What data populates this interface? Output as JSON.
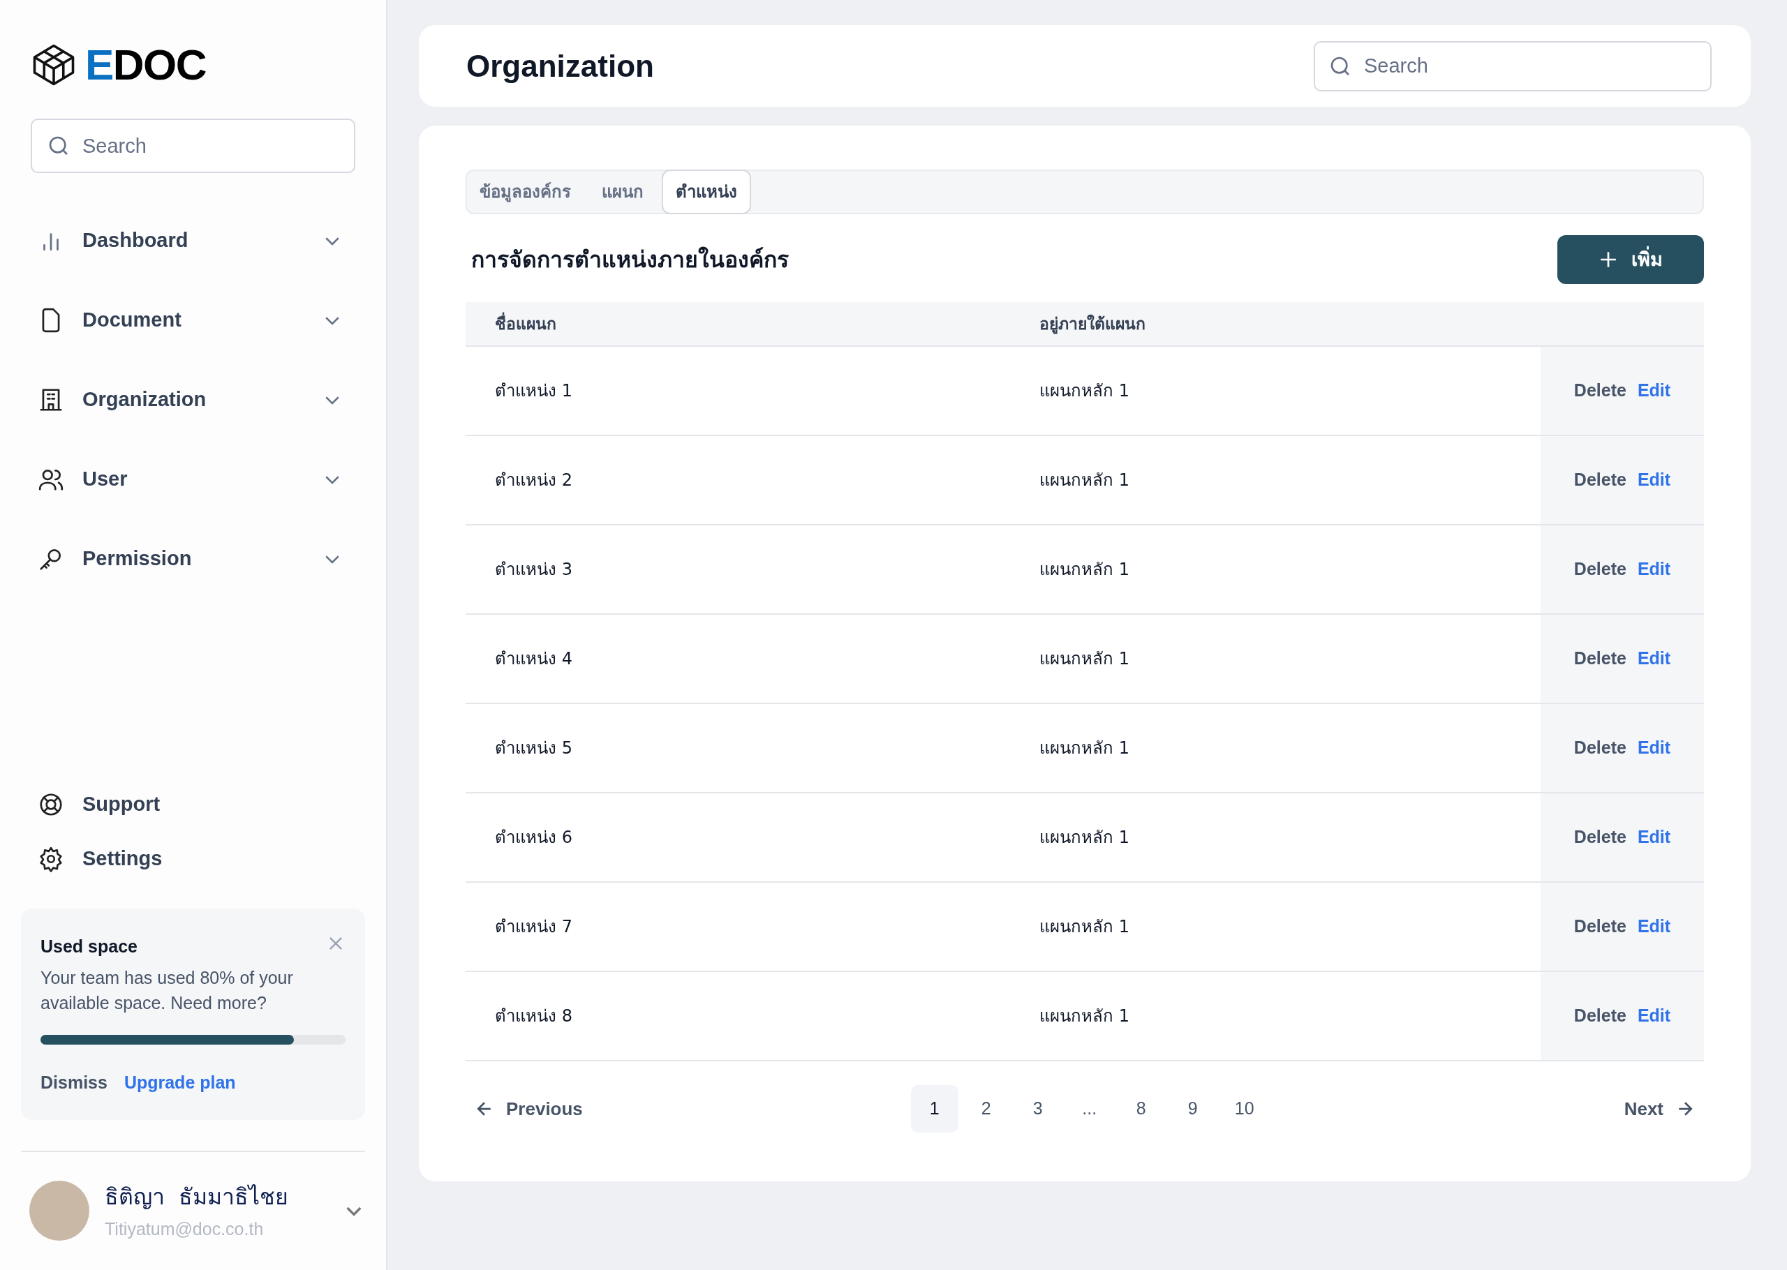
{
  "brand": {
    "prefix": "E",
    "rest": "DOC"
  },
  "sidebar": {
    "search": {
      "placeholder": "Search"
    },
    "items": [
      {
        "label": "Dashboard",
        "expanded": false
      },
      {
        "label": "Document",
        "expanded": false
      },
      {
        "label": "Organization",
        "expanded": false
      },
      {
        "label": "User",
        "expanded": false
      },
      {
        "label": "Permission",
        "expanded": false
      }
    ],
    "footer_items": [
      {
        "label": "Support"
      },
      {
        "label": "Settings"
      }
    ],
    "usage_card": {
      "title": "Used space",
      "text": "Your team has used 80% of your available space. Need more?",
      "level": 0.83,
      "dismiss": "Dismiss",
      "upgrade": "Upgrade plan"
    },
    "user": {
      "name": "ธิติญา  ธัมมาธิไชย",
      "email": "Titiyatum@doc.co.th"
    }
  },
  "header": {
    "title": "Organization",
    "search": {
      "placeholder": "Search"
    }
  },
  "tabs": [
    {
      "label": "ข้อมูลองค์กร",
      "selected": false
    },
    {
      "label": "แผนก",
      "selected": false
    },
    {
      "label": "ตำแหน่ง",
      "selected": true
    }
  ],
  "section_title": "การจัดการตำแหน่งภายในองค์กร",
  "add_button": "เพิ่ม",
  "table": {
    "columns": [
      "ชื่อแผนก",
      "อยู่ภายใต้แผนก"
    ],
    "rows": [
      {
        "name": "ตำแหน่ง 1",
        "parent": "แผนกหลัก 1",
        "delete": "Delete",
        "edit": "Edit"
      },
      {
        "name": "ตำแหน่ง 2",
        "parent": "แผนกหลัก 1",
        "delete": "Delete",
        "edit": "Edit"
      },
      {
        "name": "ตำแหน่ง 3",
        "parent": "แผนกหลัก 1",
        "delete": "Delete",
        "edit": "Edit"
      },
      {
        "name": "ตำแหน่ง 4",
        "parent": "แผนกหลัก 1",
        "delete": "Delete",
        "edit": "Edit"
      },
      {
        "name": "ตำแหน่ง 5",
        "parent": "แผนกหลัก 1",
        "delete": "Delete",
        "edit": "Edit"
      },
      {
        "name": "ตำแหน่ง 6",
        "parent": "แผนกหลัก 1",
        "delete": "Delete",
        "edit": "Edit"
      },
      {
        "name": "ตำแหน่ง 7",
        "parent": "แผนกหลัก 1",
        "delete": "Delete",
        "edit": "Edit"
      },
      {
        "name": "ตำแหน่ง 8",
        "parent": "แผนกหลัก 1",
        "delete": "Delete",
        "edit": "Edit"
      }
    ]
  },
  "pagination": {
    "previous": "Previous",
    "next": "Next",
    "pages": [
      {
        "label": "1",
        "selected": true
      },
      {
        "label": "2",
        "selected": false
      },
      {
        "label": "3",
        "selected": false
      },
      {
        "label": "...",
        "selected": false
      },
      {
        "label": "8",
        "selected": false
      },
      {
        "label": "9",
        "selected": false
      },
      {
        "label": "10",
        "selected": false
      }
    ]
  }
}
